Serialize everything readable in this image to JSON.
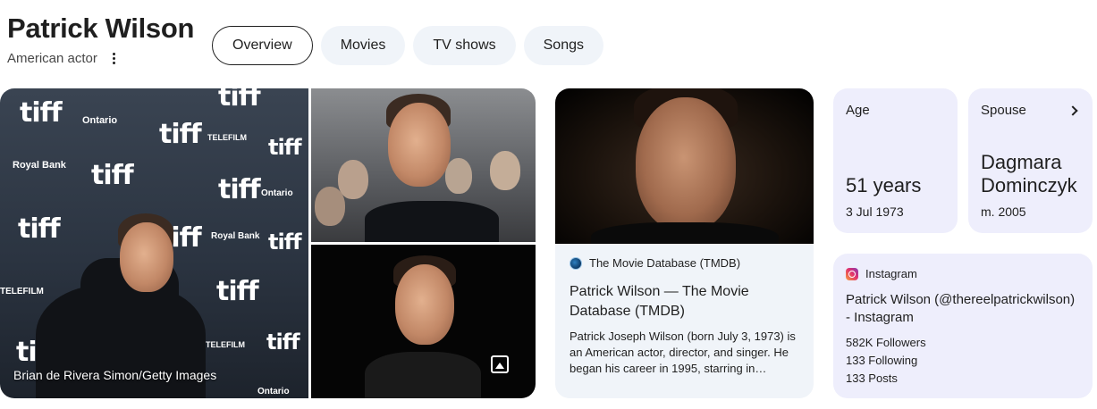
{
  "header": {
    "title": "Patrick Wilson",
    "subtitle": "American actor"
  },
  "tabs": [
    {
      "label": "Overview",
      "active": true
    },
    {
      "label": "Movies",
      "active": false
    },
    {
      "label": "TV shows",
      "active": false
    },
    {
      "label": "Songs",
      "active": false
    }
  ],
  "images": {
    "main_backdrop_logos": [
      "tiff",
      "Ontario",
      "TELEFILM",
      "Royal Bank"
    ],
    "main_credit": "Brian de Rivera Simon/Getty Images"
  },
  "web_result": {
    "source": "The Movie Database (TMDB)",
    "title": "Patrick Wilson — The Movie Database (TMDB)",
    "snippet": "Patrick Joseph Wilson (born July 3, 1973) is an American actor, director, and singer. He began his career in 1995, starring in…"
  },
  "facts": {
    "age": {
      "label": "Age",
      "value": "51 years",
      "sub": "3 Jul 1973"
    },
    "spouse": {
      "label": "Spouse",
      "value": "Dagmara Dominczyk",
      "sub": "m. 2005"
    }
  },
  "instagram": {
    "label": "Instagram",
    "name": "Patrick Wilson (@thereelpatrickwilson) - Instagram",
    "followers": "582K Followers",
    "following": "133 Following",
    "posts": "133 Posts"
  },
  "colors": {
    "fact_card_bg": "#eeeefc",
    "tab_bg": "#f0f4f9",
    "web_card_bg": "#f0f4f9"
  }
}
